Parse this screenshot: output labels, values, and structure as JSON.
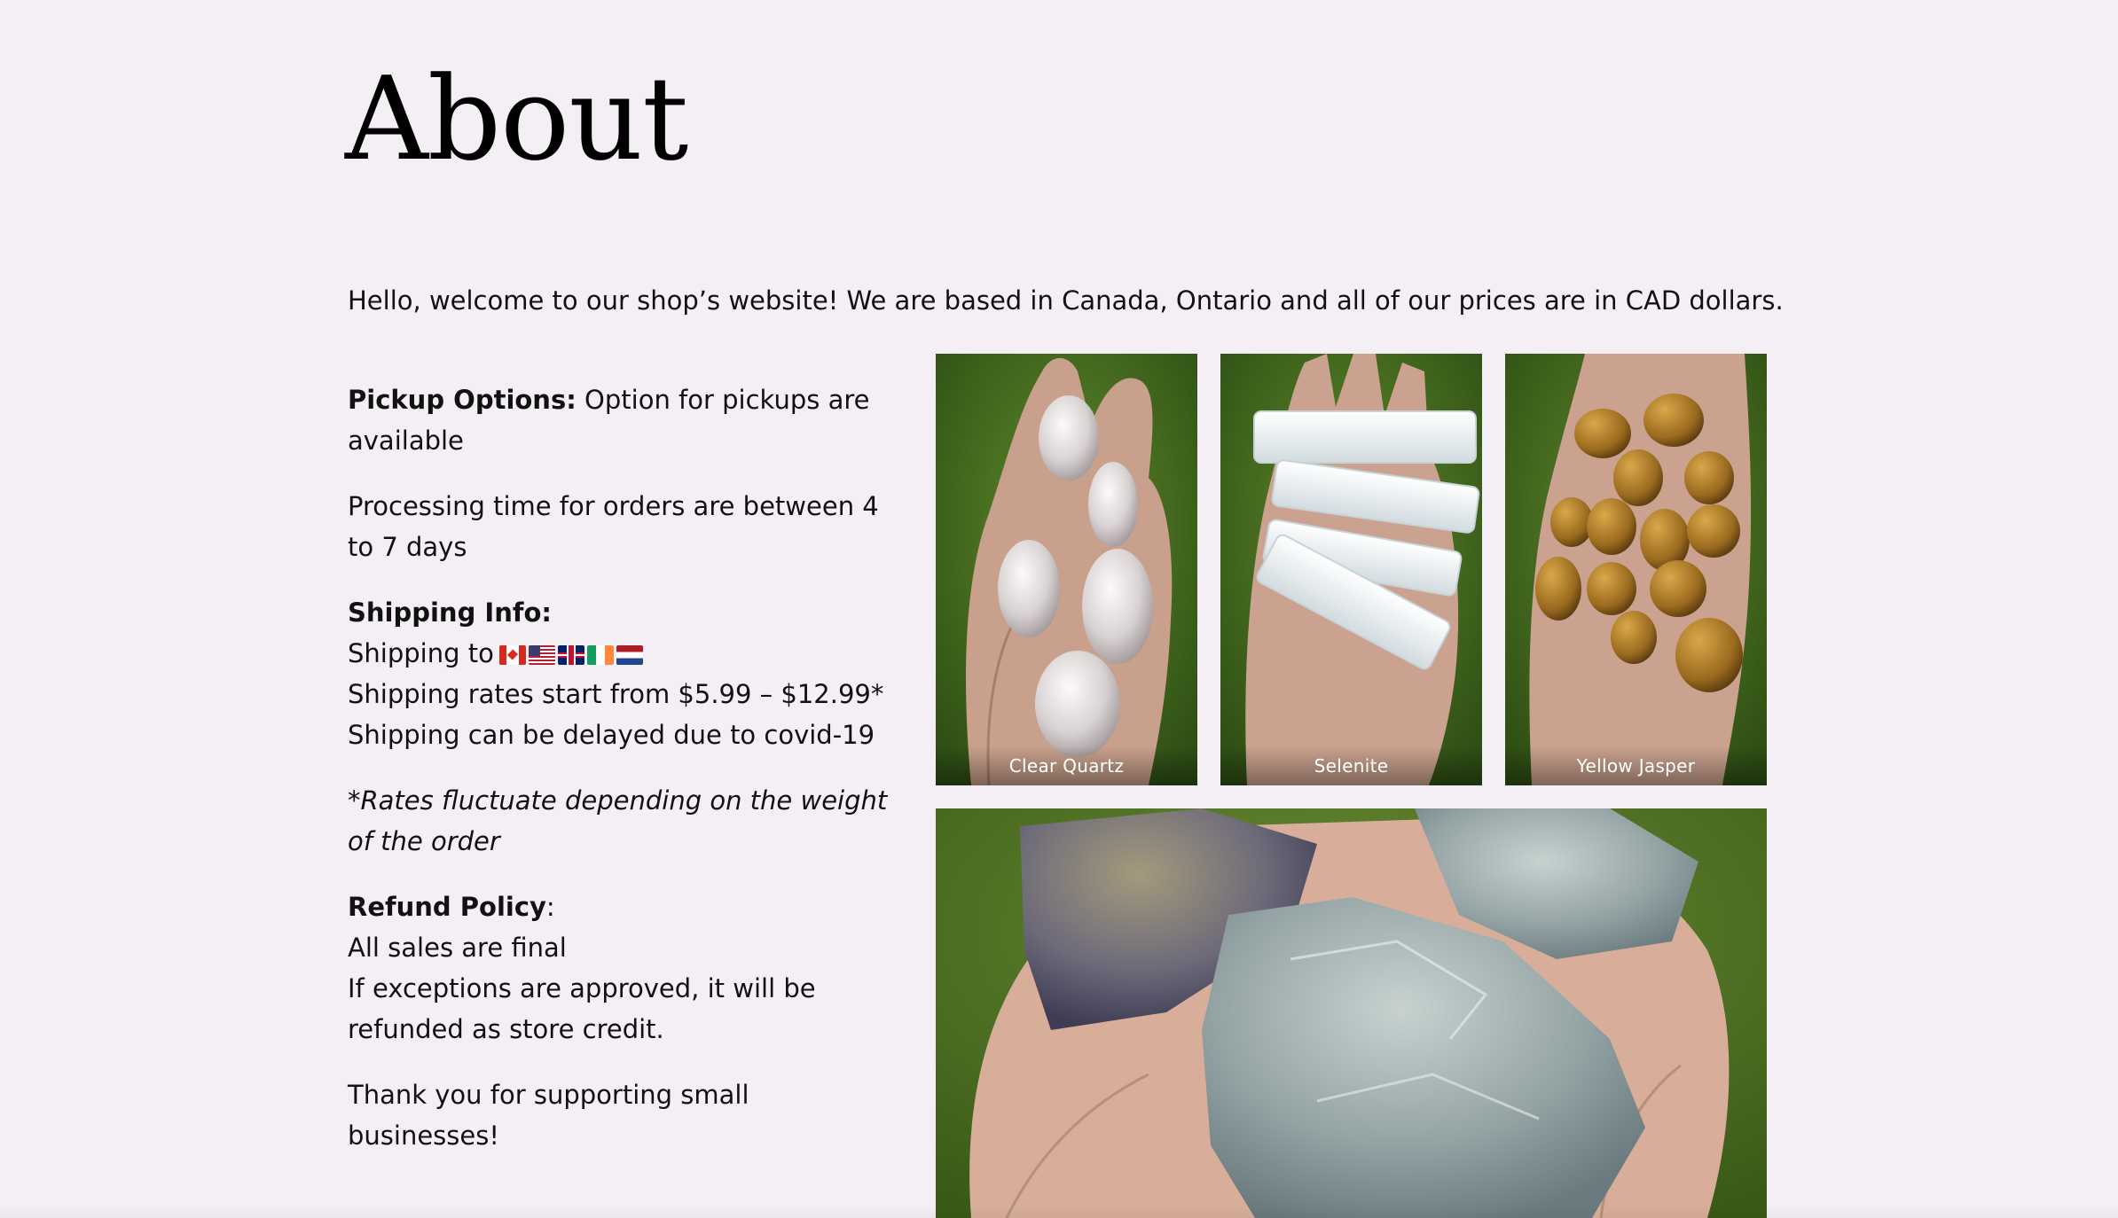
{
  "page": {
    "title": "About",
    "intro": "Hello, welcome to our shop’s website! We are based in Canada, Ontario and all of our prices are in CAD dollars."
  },
  "pickup": {
    "label": "Pickup Options:",
    "text": " Option for pickups are available"
  },
  "processing": {
    "text": "Processing time for orders are between 4 to 7 days"
  },
  "shipping": {
    "label": "Shipping Info:",
    "to_text": "Shipping to",
    "flags": [
      "canada-flag",
      "usa-flag",
      "uk-flag",
      "ireland-flag",
      "netherlands-flag"
    ],
    "rates": "Shipping rates start from $5.99 – $12.99*",
    "delay": "Shipping can be delayed due to covid-19"
  },
  "rates_note": {
    "text": "*Rates fluctuate depending on the weight of the order"
  },
  "refund": {
    "label": "Refund Policy",
    "colon": ":",
    "line1": "All sales are final",
    "line2": "If exceptions are approved, it will be refunded as store credit."
  },
  "thanks": {
    "text": "Thank you for supporting small businesses!"
  },
  "gallery": {
    "items": [
      {
        "caption": "Clear Quartz"
      },
      {
        "caption": "Selenite"
      },
      {
        "caption": "Yellow Jasper"
      },
      {
        "caption": ""
      }
    ]
  },
  "colors": {
    "background": "#f3eff5",
    "text": "#111111",
    "grass": "#3f6a1e"
  }
}
